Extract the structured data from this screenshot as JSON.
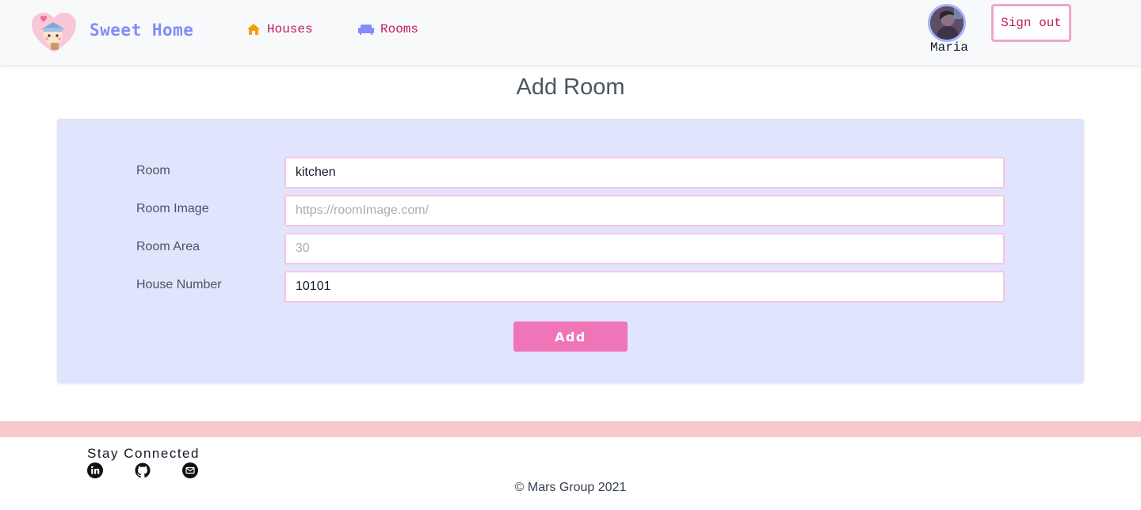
{
  "nav": {
    "brand": "Sweet Home",
    "links": [
      {
        "label": "Houses",
        "icon": "home-icon",
        "color": "#f59e0b"
      },
      {
        "label": "Rooms",
        "icon": "sofa-icon",
        "color": "#818cf8"
      }
    ],
    "user": {
      "name": "Maria"
    },
    "signout_label": "Sign out"
  },
  "page": {
    "title": "Add Room"
  },
  "form": {
    "fields": [
      {
        "label": "Room",
        "value": "kitchen",
        "placeholder": ""
      },
      {
        "label": "Room Image",
        "value": "",
        "placeholder": "https://roomImage.com/"
      },
      {
        "label": "Room Area",
        "value": "",
        "placeholder": "30"
      },
      {
        "label": "House Number",
        "value": "10101",
        "placeholder": ""
      }
    ],
    "submit_label": "Add"
  },
  "footer": {
    "stay_connected": "Stay Connected",
    "social": [
      "linkedin-icon",
      "github-icon",
      "mail-icon"
    ],
    "copyright": "© Mars Group 2021"
  },
  "colors": {
    "accent_pink": "#f075b8",
    "accent_indigo": "#818cf8",
    "card_bg": "#e0e4fc",
    "footer_bar": "#f7c9ca"
  }
}
